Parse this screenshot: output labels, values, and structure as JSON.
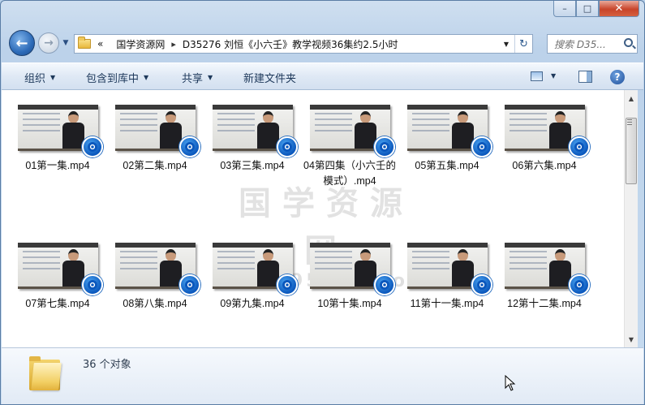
{
  "window": {
    "minimize_glyph": "–",
    "maximize_glyph": "□",
    "close_glyph": "✕"
  },
  "nav": {
    "back_glyph": "←",
    "forward_glyph": "→",
    "history_glyph": "▼",
    "overflow_glyph": "«",
    "breadcrumbs": [
      "国学资源网",
      "D35276 刘恒《小六壬》教学视频36集约2.5小时"
    ],
    "separator_glyph": "▸",
    "dropdown_glyph": "▼",
    "refresh_glyph": "↻",
    "search_placeholder": "搜索 D35..."
  },
  "toolbar": {
    "organize": "组织",
    "include_library": "包含到库中",
    "share": "共享",
    "new_folder": "新建文件夹",
    "dropdown_glyph": "▼",
    "help_glyph": "?"
  },
  "watermark": {
    "title": "国学资源网",
    "url": "www.95959.com"
  },
  "files": [
    {
      "name": "01第一集.mp4"
    },
    {
      "name": "02第二集.mp4"
    },
    {
      "name": "03第三集.mp4"
    },
    {
      "name": "04第四集（小六壬的模式）.mp4"
    },
    {
      "name": "05第五集.mp4"
    },
    {
      "name": "06第六集.mp4"
    },
    {
      "name": "07第七集.mp4"
    },
    {
      "name": "08第八集.mp4"
    },
    {
      "name": "09第九集.mp4"
    },
    {
      "name": "10第十集.mp4"
    },
    {
      "name": "11第十一集.mp4"
    },
    {
      "name": "12第十二集.mp4"
    }
  ],
  "scrollbar": {
    "up_glyph": "▲",
    "down_glyph": "▼"
  },
  "details": {
    "item_count": "36 个对象"
  }
}
